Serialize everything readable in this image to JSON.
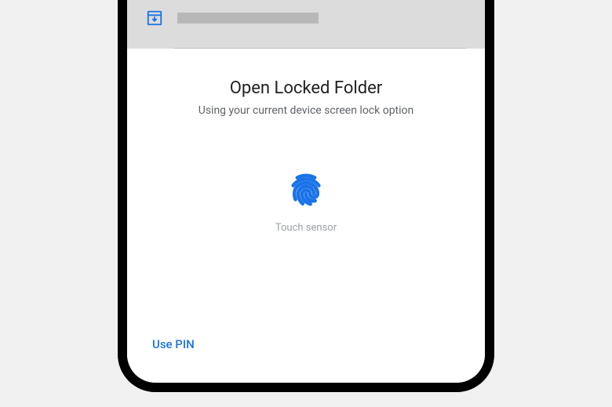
{
  "prompt": {
    "title": "Open Locked Folder",
    "subtitle": "Using your current device screen lock option",
    "touch_label": "Touch sensor",
    "use_pin_label": "Use PIN"
  }
}
